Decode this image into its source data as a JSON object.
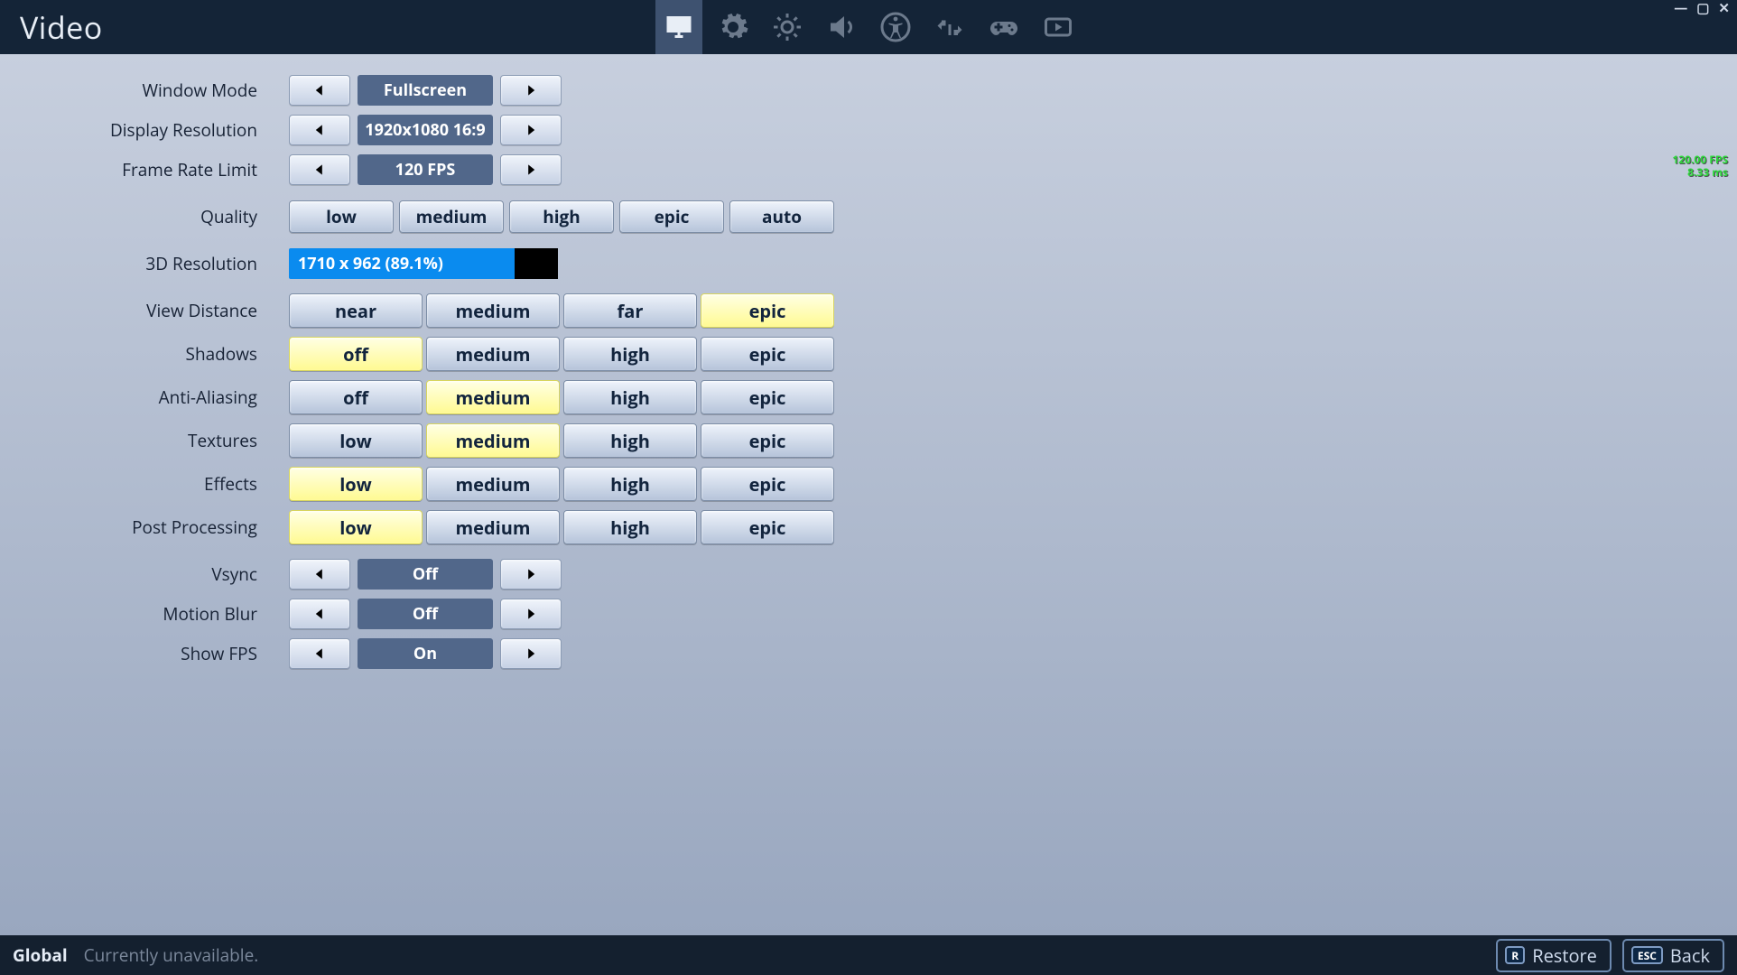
{
  "title": "Video",
  "fps_overlay": {
    "fps": "120.00 FPS",
    "ms": "8.33 ms"
  },
  "tabs": [
    "display",
    "settings",
    "brightness",
    "audio",
    "accessibility",
    "input",
    "controller",
    "replay"
  ],
  "active_tab": 0,
  "settings": {
    "window_mode": {
      "label": "Window Mode",
      "value": "Fullscreen"
    },
    "display_resolution": {
      "label": "Display Resolution",
      "value": "1920x1080 16:9"
    },
    "frame_rate_limit": {
      "label": "Frame Rate Limit",
      "value": "120 FPS"
    },
    "quality": {
      "label": "Quality",
      "options": [
        "low",
        "medium",
        "high",
        "epic",
        "auto"
      ],
      "selected": -1
    },
    "three_d_res": {
      "label": "3D Resolution",
      "text": "1710 x 962 (89.1%)",
      "percent": 89.1
    },
    "view_distance": {
      "label": "View Distance",
      "options": [
        "near",
        "medium",
        "far",
        "epic"
      ],
      "selected": 3
    },
    "shadows": {
      "label": "Shadows",
      "options": [
        "off",
        "medium",
        "high",
        "epic"
      ],
      "selected": 0
    },
    "anti_aliasing": {
      "label": "Anti-Aliasing",
      "options": [
        "off",
        "medium",
        "high",
        "epic"
      ],
      "selected": 1
    },
    "textures": {
      "label": "Textures",
      "options": [
        "low",
        "medium",
        "high",
        "epic"
      ],
      "selected": 1
    },
    "effects": {
      "label": "Effects",
      "options": [
        "low",
        "medium",
        "high",
        "epic"
      ],
      "selected": 0
    },
    "post_processing": {
      "label": "Post Processing",
      "options": [
        "low",
        "medium",
        "high",
        "epic"
      ],
      "selected": 0
    },
    "vsync": {
      "label": "Vsync",
      "value": "Off"
    },
    "motion_blur": {
      "label": "Motion Blur",
      "value": "Off"
    },
    "show_fps": {
      "label": "Show FPS",
      "value": "On"
    }
  },
  "footer": {
    "global": "Global",
    "status": "Currently unavailable.",
    "restore_key": "R",
    "restore": "Restore",
    "back_key": "ESC",
    "back": "Back"
  }
}
